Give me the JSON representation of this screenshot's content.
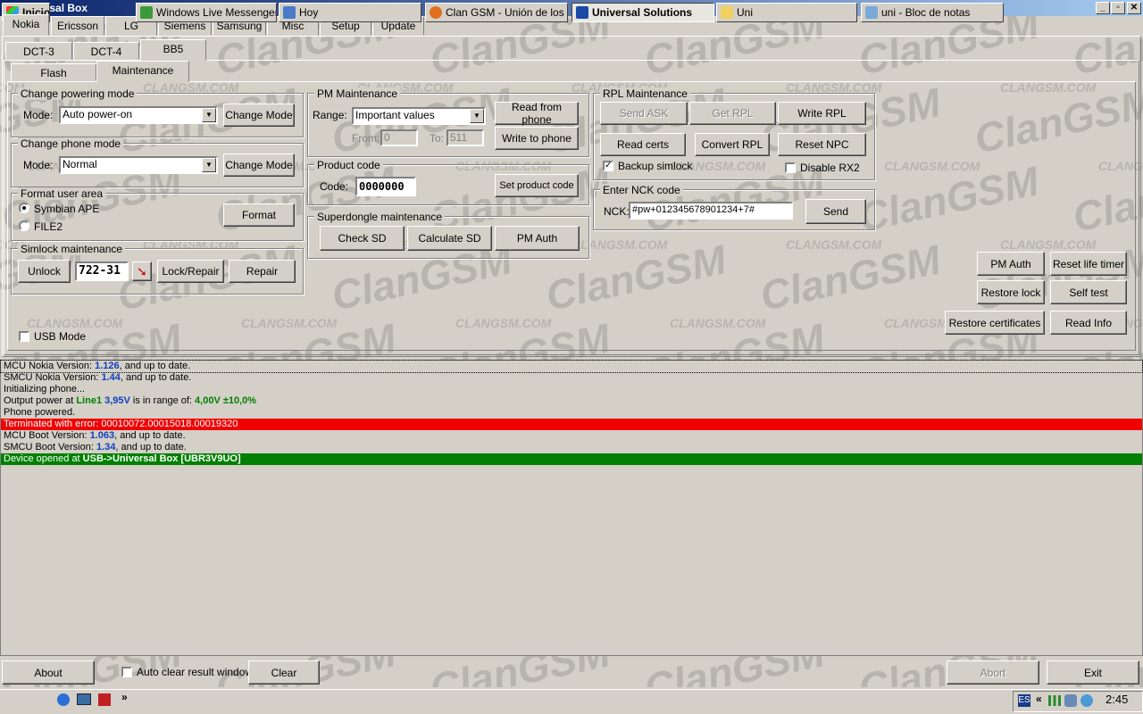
{
  "window": {
    "title": "Universal Box"
  },
  "watermark": {
    "big": "ClanGSM",
    "small": "CLANGSM.COM"
  },
  "brand_tabs": [
    "Nokia",
    "Ericsson",
    "LG",
    "Siemens",
    "Samsung",
    "Misc",
    "Setup",
    "Update"
  ],
  "model_tabs": [
    "DCT-3",
    "DCT-4",
    "BB5"
  ],
  "sub_tabs": [
    "Flash",
    "Maintenance"
  ],
  "powering": {
    "title": "Change powering mode",
    "mode_label": "Mode:",
    "mode_value": "Auto power-on",
    "button": "Change Mode"
  },
  "phone_mode": {
    "title": "Change phone mode",
    "mode_label": "Mode:",
    "mode_value": "Normal",
    "button": "Change Mode"
  },
  "format": {
    "title": "Format user area",
    "option1": "Symbian APE",
    "option2": "FILE2",
    "button": "Format"
  },
  "simlock": {
    "title": "Simlock maintenance",
    "unlock": "Unlock",
    "code": "722-31",
    "lock": "Lock/Repair",
    "repair": "Repair"
  },
  "usb_mode": "USB Mode",
  "pm": {
    "title": "PM Maintenance",
    "range_label": "Range:",
    "range_value": "Important values",
    "from_label": "From:",
    "from_value": "0",
    "to_label": "To:",
    "to_value": "511",
    "read": "Read from phone",
    "write": "Write to phone"
  },
  "product": {
    "title": "Product code",
    "code_label": "Code:",
    "code_value": "0000000",
    "button": "Set product code"
  },
  "superdongle": {
    "title": "Superdongle maintenance",
    "check": "Check SD",
    "calc": "Calculate SD",
    "auth": "PM Auth"
  },
  "rpl": {
    "title": "RPL Maintenance",
    "send_ask": "Send ASK",
    "get_rpl": "Get RPL",
    "write_rpl": "Write RPL",
    "read_certs": "Read certs",
    "convert_rpl": "Convert RPL",
    "reset_npc": "Reset NPC",
    "backup": "Backup simlock",
    "disable_rx2": "Disable RX2"
  },
  "nck": {
    "title": "Enter NCK code",
    "label": "NCK:",
    "value": "#pw+012345678901234+7#",
    "button": "Send"
  },
  "misc_buttons": {
    "pm_auth": "PM Auth",
    "reset_life": "Reset life timer",
    "restore_lock": "Restore lock",
    "self_test": "Self test",
    "restore_certs": "Restore certificates",
    "read_info": "Read Info"
  },
  "log": [
    {
      "parts": [
        [
          "MCU Nokia Version: ",
          ""
        ],
        [
          "1.126",
          "blue"
        ],
        [
          ", and up to date.",
          ""
        ]
      ],
      "style": "sel"
    },
    {
      "parts": [
        [
          "SMCU Nokia Version: ",
          ""
        ],
        [
          "1.44",
          "blue"
        ],
        [
          ", and up to date.",
          ""
        ]
      ],
      "style": ""
    },
    {
      "parts": [
        [
          "Initializing phone...",
          ""
        ]
      ],
      "style": ""
    },
    {
      "parts": [
        [
          "Output power at ",
          ""
        ],
        [
          "Line1",
          "green"
        ],
        [
          " ",
          ""
        ],
        [
          "3,95V",
          "blue"
        ],
        [
          " is in range of: ",
          ""
        ],
        [
          "4,00V ±10,0%",
          "green"
        ]
      ],
      "style": ""
    },
    {
      "parts": [
        [
          "Phone powered.",
          ""
        ]
      ],
      "style": ""
    },
    {
      "parts": [
        [
          "Terminated with error: 00010072.00015018.00019320",
          ""
        ]
      ],
      "style": "err"
    },
    {
      "parts": [
        [
          "MCU Boot Version: ",
          ""
        ],
        [
          "1.063",
          "blue"
        ],
        [
          ", and up to date.",
          ""
        ]
      ],
      "style": ""
    },
    {
      "parts": [
        [
          "SMCU Boot Version: ",
          ""
        ],
        [
          "1.34",
          "blue"
        ],
        [
          ", and up to date.",
          ""
        ]
      ],
      "style": ""
    },
    {
      "parts": [
        [
          "Device opened at ",
          ""
        ],
        [
          "USB->Universal Box [UBR3V9UO]",
          "bold"
        ]
      ],
      "style": "ok"
    }
  ],
  "bottom": {
    "about": "About",
    "auto_clear": "Auto clear result window",
    "clear": "Clear",
    "abort": "Abort",
    "exit": "Exit"
  },
  "taskbar": {
    "start": "Inicio",
    "chevron": "»",
    "items": [
      "Windows Live Messenger",
      "Hoy",
      "Clan GSM - Unión de los ...",
      "Universal Solutions",
      "Uni",
      "uni - Bloc de notas"
    ],
    "tray_chevron": "«",
    "time": "2:45"
  },
  "colors": {
    "error": "#f00000",
    "ok": "#008000",
    "title_start": "#0a246a",
    "title_end": "#a6caf0"
  }
}
